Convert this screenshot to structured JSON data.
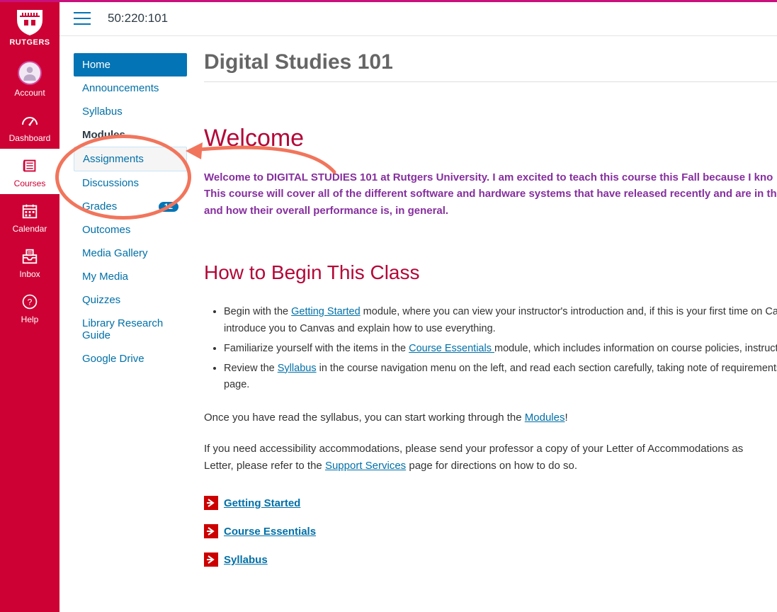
{
  "brand": "RUTGERS",
  "global_nav": [
    {
      "id": "account",
      "label": "Account",
      "active": false
    },
    {
      "id": "dashboard",
      "label": "Dashboard",
      "active": false
    },
    {
      "id": "courses",
      "label": "Courses",
      "active": true
    },
    {
      "id": "calendar",
      "label": "Calendar",
      "active": false
    },
    {
      "id": "inbox",
      "label": "Inbox",
      "active": false
    },
    {
      "id": "help",
      "label": "Help",
      "active": false
    }
  ],
  "breadcrumb": "50:220:101",
  "course_nav": {
    "items": [
      {
        "label": "Home",
        "active": true
      },
      {
        "label": "Announcements"
      },
      {
        "label": "Syllabus"
      },
      {
        "label": "Modules",
        "dark": true
      },
      {
        "label": "Assignments",
        "selected": true
      },
      {
        "label": "Discussions"
      },
      {
        "label": "Grades",
        "badge": "12"
      },
      {
        "label": "Outcomes"
      },
      {
        "label": "Media Gallery"
      },
      {
        "label": "My Media"
      },
      {
        "label": "Quizzes"
      },
      {
        "label": "Library Research Guide"
      },
      {
        "label": "Google Drive"
      }
    ]
  },
  "page": {
    "title": "Digital Studies 101",
    "welcome_heading": "Welcome",
    "welcome_body_line1": "Welcome to DIGITAL STUDIES 101 at Rutgers University. I am excited to teach this course this Fall because I kno",
    "welcome_body_line2": "This course will cover all of the different software and hardware systems that have released recently and are in th",
    "welcome_body_line3": "and how their overall performance is, in general.",
    "howto_heading": "How to Begin This Class",
    "bullets": {
      "b1_pre": "Begin with the ",
      "b1_link": "Getting Started",
      "b1_post": " module, where you can view your instructor's introduction and, if this is your first time on Canva",
      "b1_wrap": "introduce you to Canvas and explain how to use everything.",
      "b2_pre": "Familiarize yourself with the items in the ",
      "b2_link": "Course Essentials ",
      "b2_post": "module, which includes information on course policies, instructions",
      "b3_pre": "Review the ",
      "b3_link": "Syllabus",
      "b3_post": " in the course navigation menu on the left, and read each section carefully, taking note of requirements, pol",
      "b3_wrap": "page."
    },
    "para1_pre": "Once you have read the syllabus, you can start working through the ",
    "para1_link": "Modules",
    "para1_post": "!",
    "para2_line1": "If you need accessibility accommodations, please send your professor a copy of your Letter of Accommodations as ",
    "para2_line2_pre": "Letter, please refer to the ",
    "para2_link": "Support Services",
    "para2_line2_post": " page for directions on how to do so.",
    "quicklinks": [
      "Getting Started",
      "Course Essentials",
      "Syllabus"
    ]
  }
}
